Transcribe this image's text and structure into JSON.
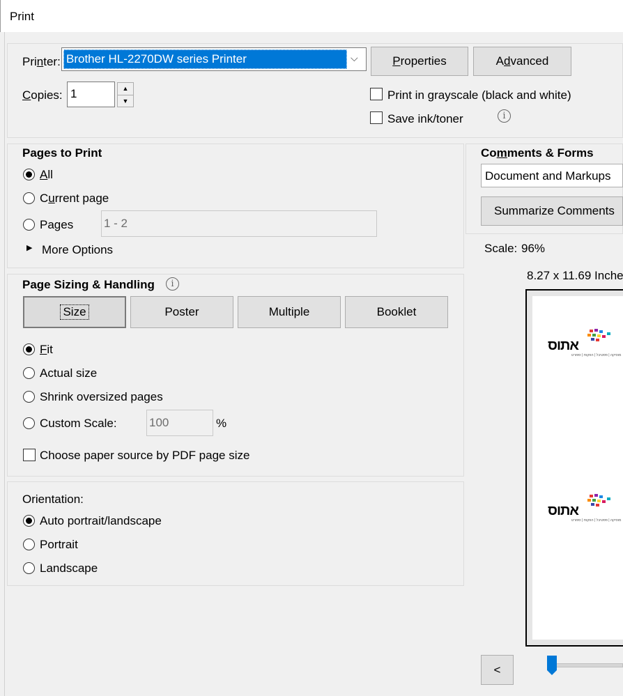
{
  "window": {
    "title": "Print"
  },
  "printer": {
    "label": "Printer:",
    "selected": "Brother HL-2270DW series Printer",
    "properties_label": "Properties",
    "advanced_label": "Advanced",
    "copies_label": "Copies:",
    "copies_value": "1",
    "grayscale_label": "Print in grayscale (black and white)",
    "save_ink_label": "Save ink/toner"
  },
  "pages": {
    "heading": "Pages to Print",
    "all_label": "All",
    "current_label": "Current page",
    "pages_label": "Pages",
    "range_placeholder": "1 - 2",
    "more_options": "More Options"
  },
  "sizing": {
    "heading": "Page Sizing & Handling",
    "tabs": [
      "Size",
      "Poster",
      "Multiple",
      "Booklet"
    ],
    "fit_label": "Fit",
    "actual_label": "Actual size",
    "shrink_label": "Shrink oversized pages",
    "custom_label": "Custom Scale:",
    "custom_value": "100",
    "percent": "%",
    "paper_source_label": "Choose paper source by PDF page size"
  },
  "orientation": {
    "heading": "Orientation:",
    "auto_label": "Auto portrait/landscape",
    "portrait_label": "Portrait",
    "landscape_label": "Landscape"
  },
  "comments": {
    "heading": "Comments & Forms",
    "selected": "Document and Markups",
    "summarize_label": "Summarize Comments"
  },
  "preview": {
    "scale_label": "Scale:",
    "scale_value": "96%",
    "page_size": "8.27 x 11.69 Inche",
    "logo_text": "אתוס",
    "logo_subtext": "מוסיקה | פסטיבל | הפקות | ספורט",
    "prev_label": "<"
  },
  "colors": {
    "selection": "#0078d7",
    "slider": "#0078d7"
  }
}
